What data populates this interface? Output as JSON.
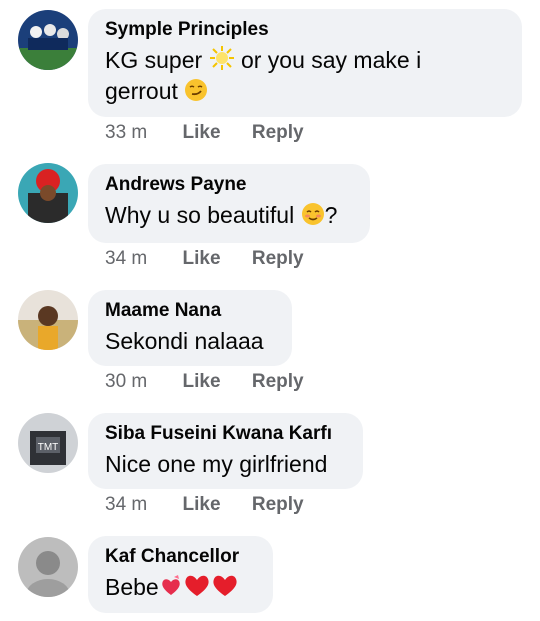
{
  "comments": [
    {
      "author": "Symple Principles",
      "text_parts": [
        "KG super",
        "or you say make i",
        "gerrout"
      ],
      "time": "33 m",
      "like": "Like",
      "reply": "Reply"
    },
    {
      "author": "Andrews Payne",
      "text_parts": [
        "Why u so beautiful",
        "?"
      ],
      "time": "34 m",
      "like": "Like",
      "reply": "Reply"
    },
    {
      "author": "Maame Nana",
      "text_parts": [
        "Sekondi nalaaa"
      ],
      "time": "30 m",
      "like": "Like",
      "reply": "Reply"
    },
    {
      "author": "Siba Fuseini Kwana Karfı",
      "text_parts": [
        "Nice one my girlfriend"
      ],
      "time": "34 m",
      "like": "Like",
      "reply": "Reply"
    },
    {
      "author": "Kaf Chancellor",
      "text_parts": [
        "Bebe"
      ],
      "time": "",
      "like": "",
      "reply": ""
    }
  ],
  "colors": {
    "bubble": "#f0f2f5",
    "meta": "#65676b",
    "text": "#050505"
  }
}
